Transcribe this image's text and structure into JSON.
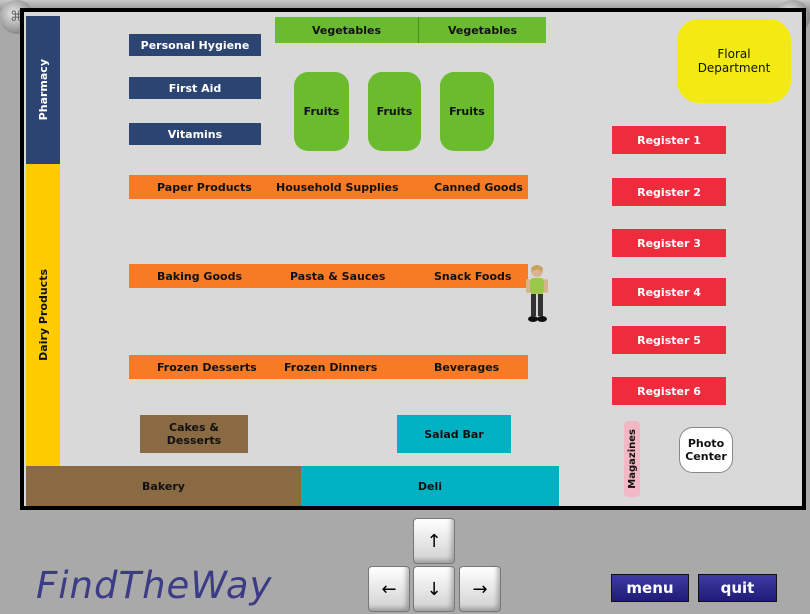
{
  "app": {
    "logo": "FindTheWay"
  },
  "sections": {
    "pharmacy": "Pharmacy",
    "dairy": "Dairy Products",
    "vegetables": [
      "Vegetables",
      "Vegetables"
    ],
    "personal_hygiene": "Personal Hygiene",
    "first_aid": "First Aid",
    "vitamins": "Vitamins",
    "fruits": [
      "Fruits",
      "Fruits",
      "Fruits"
    ],
    "floral": "Floral\nDepartment",
    "aisle1": [
      "Paper Products",
      "Household Supplies",
      "Canned Goods"
    ],
    "aisle2": [
      "Baking Goods",
      "Pasta & Sauces",
      "Snack Foods"
    ],
    "aisle3": [
      "Frozen Desserts",
      "Frozen Dinners",
      "Beverages"
    ],
    "registers": [
      "Register 1",
      "Register 2",
      "Register 3",
      "Register 4",
      "Register 5",
      "Register 6"
    ],
    "cakes": "Cakes & Desserts",
    "salad_bar": "Salad Bar",
    "magazines": "Magazines",
    "photo_center": "Photo\nCenter",
    "bakery": "Bakery",
    "deli": "Deli"
  },
  "controls": {
    "up": "↑",
    "left": "←",
    "down": "↓",
    "right": "→",
    "menu": "menu",
    "quit": "quit"
  },
  "colors": {
    "navy": "#2c4472",
    "green": "#6abb2e",
    "orange": "#f77a25",
    "red": "#ef2b3e",
    "yellow": "#f2ea12",
    "dairy_yellow": "#ffcc00",
    "brown": "#8a6a42",
    "teal": "#00b0c3",
    "logo": "#3b3b86"
  }
}
